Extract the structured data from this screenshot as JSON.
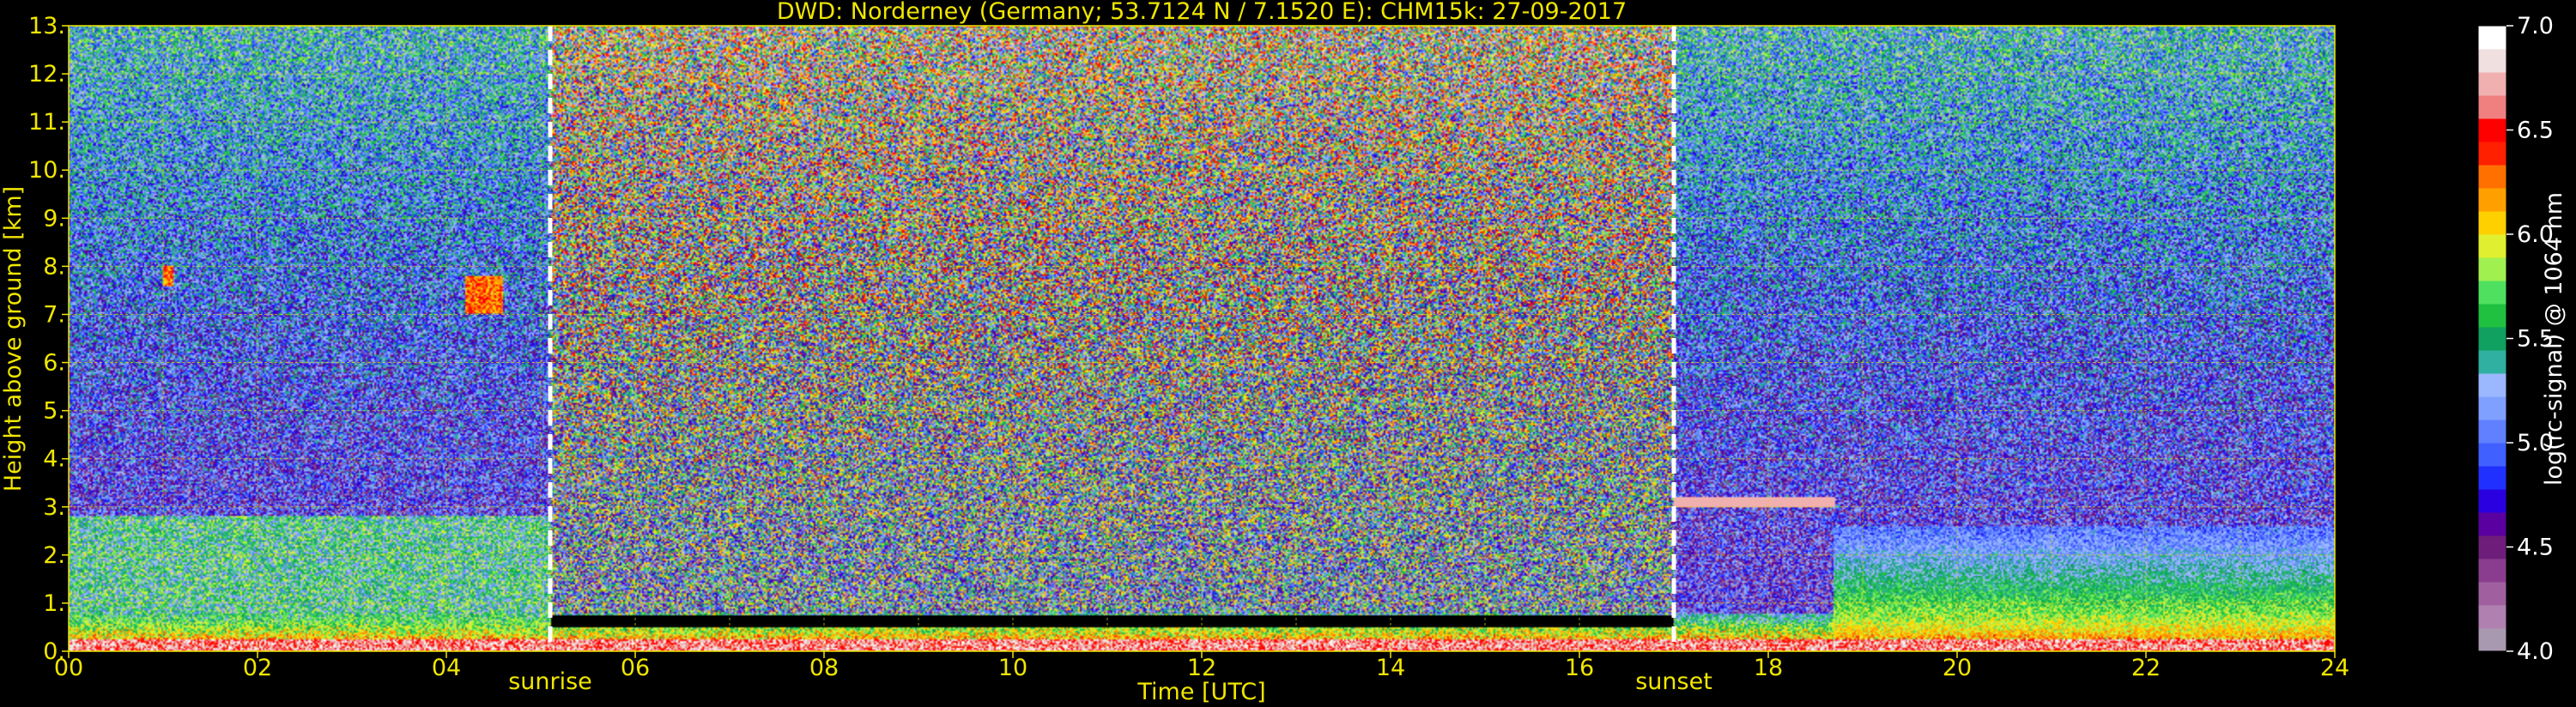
{
  "chart_data": {
    "type": "heatmap",
    "title": "DWD: Norderney (Germany; 53.7124 N / 7.1520 E):    CHM15k: 27-09-2017",
    "xlabel": "Time [UTC]",
    "ylabel": "Height above ground [km]",
    "xlim": [
      0,
      24
    ],
    "ylim": [
      0,
      13
    ],
    "x_ticks": [
      "00",
      "02",
      "04",
      "06",
      "08",
      "10",
      "12",
      "14",
      "16",
      "18",
      "20",
      "22",
      "24"
    ],
    "y_ticks": [
      "0.",
      "1.",
      "2.",
      "3.",
      "4.",
      "5.",
      "6.",
      "7.",
      "8.",
      "9.",
      "10.",
      "11.",
      "12.",
      "13."
    ],
    "grid": true,
    "grid_color": "#ffff00",
    "background": "#000000",
    "annotations": [
      {
        "label": "sunrise",
        "x": 5.1
      },
      {
        "label": "sunset",
        "x": 17.0
      }
    ],
    "colorbar": {
      "label": "log(rc-signal) @ 1064 nm",
      "range": [
        4.0,
        7.0
      ],
      "ticks": [
        "4.0",
        "4.5",
        "5.0",
        "5.5",
        "6.0",
        "6.5",
        "7.0"
      ],
      "colors": [
        "#a898b0",
        "#b080b0",
        "#a060a0",
        "#8a3d8e",
        "#6e1e7a",
        "#5a00a0",
        "#2a00e0",
        "#2030ff",
        "#4060ff",
        "#6080ff",
        "#7fa0ff",
        "#9bb8ff",
        "#30b0a0",
        "#10a060",
        "#20c040",
        "#50e060",
        "#a0f050",
        "#e0f030",
        "#ffd000",
        "#ffa000",
        "#ff7000",
        "#ff2000",
        "#ff0000",
        "#f08080",
        "#f0b0b0",
        "#f0e0e0",
        "#ffffff"
      ]
    },
    "features": [
      {
        "name": "boundary layer aerosol",
        "x_range": [
          0,
          24
        ],
        "height_km": [
          0,
          0.8
        ]
      },
      {
        "name": "residual layer",
        "x_range": [
          0,
          5.1
        ],
        "height_km": [
          0.3,
          2.8
        ]
      },
      {
        "name": "cloud layer",
        "x_range": [
          17.0,
          18.7
        ],
        "height_km": [
          3.0,
          3.2
        ]
      },
      {
        "name": "cirrus patch",
        "x_range": [
          1.0,
          1.1
        ],
        "height_km": [
          7.6,
          8.0
        ]
      },
      {
        "name": "cirrus patch",
        "x_range": [
          4.2,
          4.6
        ],
        "height_km": [
          7.0,
          7.8
        ]
      },
      {
        "name": "aerosol layer",
        "x_range": [
          18.7,
          24
        ],
        "height_km": [
          0.3,
          2.6
        ]
      }
    ]
  }
}
